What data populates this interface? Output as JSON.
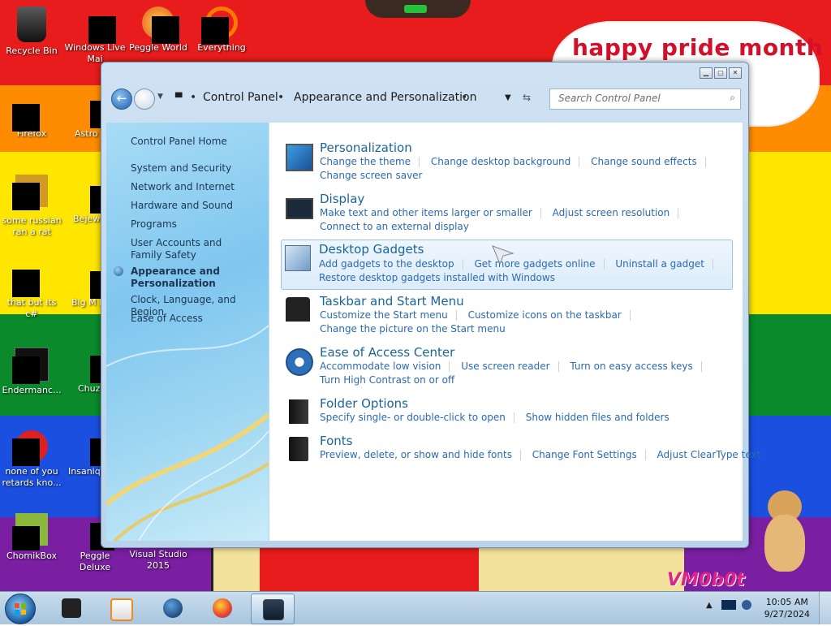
{
  "desktop": {
    "bubble_text": "happy pride month",
    "watermark": "VM0b0t",
    "icons": [
      {
        "label": "Recycle Bin"
      },
      {
        "label": "Windows Live Mai"
      },
      {
        "label": "Peggle World"
      },
      {
        "label": "Everything"
      },
      {
        "label": "Firefox"
      },
      {
        "label": "Astro Delu"
      },
      {
        "label": "some russian ran a rat"
      },
      {
        "label": "Bejew Delu"
      },
      {
        "label": "that but its c#"
      },
      {
        "label": "Big M Delu"
      },
      {
        "label": "Endermanc..."
      },
      {
        "label": "Chuz Delu"
      },
      {
        "label": "none of you retards kno..."
      },
      {
        "label": "Insaniq Delu"
      },
      {
        "label": "ChomikBox"
      },
      {
        "label": "Peggle Deluxe"
      },
      {
        "label": "Visual Studio 2015"
      }
    ],
    "colors": {
      "red": "#e81c1c",
      "orange": "#ff8c00",
      "yellow": "#ffe600",
      "green": "#0a8a2a",
      "blue": "#1a4fe0",
      "purple": "#7a1fa2"
    }
  },
  "window": {
    "address": {
      "root_icon": "computer-icon",
      "crumbs": [
        "Control Panel",
        "Appearance and Personalization"
      ]
    },
    "search_placeholder": "Search Control Panel",
    "left_nav": [
      {
        "label": "Control Panel Home"
      },
      {
        "label": "System and Security"
      },
      {
        "label": "Network and Internet"
      },
      {
        "label": "Hardware and Sound"
      },
      {
        "label": "Programs"
      },
      {
        "label": "User Accounts and Family Safety"
      },
      {
        "label": "Appearance and Personalization",
        "current": true
      },
      {
        "label": "Clock, Language, and Region"
      },
      {
        "label": "Ease of Access"
      }
    ],
    "categories": [
      {
        "title": "Personalization",
        "icon": "personalization-icon",
        "lines": [
          [
            "Change the theme",
            "Change desktop background",
            "Change sound effects"
          ],
          [
            "Change screen saver"
          ]
        ]
      },
      {
        "title": "Display",
        "icon": "display-icon",
        "lines": [
          [
            "Make text and other items larger or smaller",
            "Adjust screen resolution"
          ],
          [
            "Connect to an external display"
          ]
        ]
      },
      {
        "title": "Desktop Gadgets",
        "icon": "gadgets-icon",
        "highlighted": true,
        "lines": [
          [
            "Add gadgets to the desktop",
            "Get more gadgets online",
            "Uninstall a gadget"
          ],
          [
            "Restore desktop gadgets installed with Windows"
          ]
        ]
      },
      {
        "title": "Taskbar and Start Menu",
        "icon": "taskbar-icon",
        "lines": [
          [
            "Customize the Start menu",
            "Customize icons on the taskbar"
          ],
          [
            "Change the picture on the Start menu"
          ]
        ]
      },
      {
        "title": "Ease of Access Center",
        "icon": "ease-of-access-icon",
        "lines": [
          [
            "Accommodate low vision",
            "Use screen reader",
            "Turn on easy access keys"
          ],
          [
            "Turn High Contrast on or off"
          ]
        ]
      },
      {
        "title": "Folder Options",
        "icon": "folder-options-icon",
        "lines": [
          [
            "Specify single- or double-click to open",
            "Show hidden files and folders"
          ]
        ]
      },
      {
        "title": "Fonts",
        "icon": "fonts-icon",
        "lines": [
          [
            "Preview, delete, or show and hide fonts",
            "Change Font Settings",
            "Adjust ClearType text"
          ]
        ]
      }
    ]
  },
  "taskbar": {
    "time": "10:05 AM",
    "date": "9/27/2024",
    "pinned": [
      "terminal-icon",
      "media-player-icon",
      "globe-icon",
      "firefox-icon",
      "control-panel-icon"
    ]
  }
}
